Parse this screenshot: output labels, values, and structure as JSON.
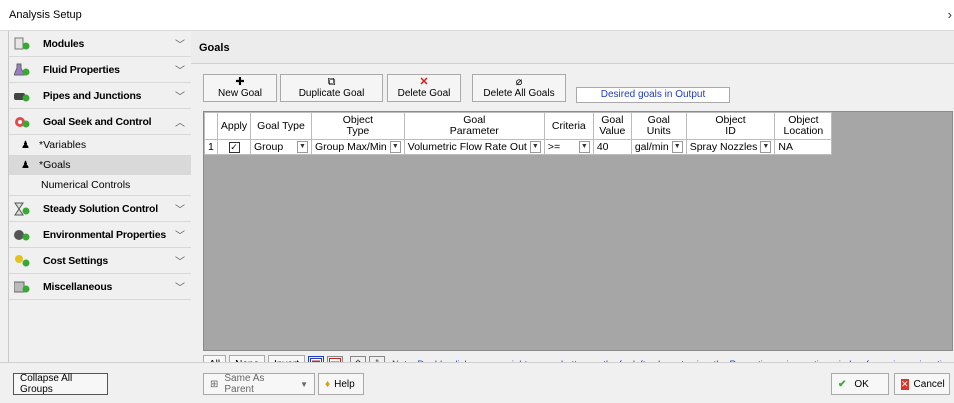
{
  "window": {
    "title": "Analysis Setup",
    "close_glyph": "›"
  },
  "sidebar": {
    "items": [
      {
        "label": "Modules",
        "icon": "modules-icon"
      },
      {
        "label": "Fluid Properties",
        "icon": "flask-icon"
      },
      {
        "label": "Pipes and Junctions",
        "icon": "pipes-icon"
      },
      {
        "label": "Goal Seek and Control",
        "icon": "goal-seek-icon"
      },
      {
        "label": "Steady Solution Control",
        "icon": "hourglass-icon"
      },
      {
        "label": "Environmental Properties",
        "icon": "environment-icon"
      },
      {
        "label": "Cost Settings",
        "icon": "cost-icon"
      },
      {
        "label": "Miscellaneous",
        "icon": "misc-icon"
      }
    ],
    "subitems": {
      "variables": "*Variables",
      "goals": "*Goals",
      "numerical": "Numerical Controls"
    }
  },
  "main": {
    "header": "Goals",
    "toolbar": {
      "new_goal": "New Goal",
      "duplicate_goal": "Duplicate Goal",
      "delete_goal": "Delete Goal",
      "delete_all_goals": "Delete All Goals",
      "desired_goals": "Desired goals in Output"
    },
    "table": {
      "headers": [
        "Apply",
        "Goal Type",
        "Object Type",
        "Goal Parameter",
        "Criteria",
        "Goal Value",
        "Goal Units",
        "Object ID",
        "Object Location"
      ],
      "header_lines": [
        [
          "Apply",
          ""
        ],
        [
          "Goal Type",
          ""
        ],
        [
          "Object",
          "Type"
        ],
        [
          "Goal",
          "Parameter"
        ],
        [
          "Criteria",
          ""
        ],
        [
          "Goal",
          "Value"
        ],
        [
          "Goal",
          "Units"
        ],
        [
          "Object",
          "ID"
        ],
        [
          "Object",
          "Location"
        ]
      ],
      "rows": [
        {
          "num": "1",
          "apply": "☑",
          "goal_type": "Group",
          "object_type": "Group Max/Min",
          "goal_parameter": "Volumetric Flow Rate Out",
          "criteria": ">=",
          "goal_value": "40",
          "goal_units": "gal/min",
          "object_id": "Spray Nozzles",
          "object_location": "NA"
        }
      ]
    },
    "bottom": {
      "all": "All",
      "none": "None",
      "invert": "Invert",
      "note": "Note: Double-click or press right mouse button on the far left column to view the Properties or inspection window for a pipe or junction."
    }
  },
  "footer": {
    "collapse": "Collapse All Groups",
    "same_as_parent": "Same As Parent",
    "help": "Help",
    "ok": "OK",
    "cancel": "Cancel"
  },
  "colors": {
    "accent_blue": "#1d3cc0",
    "grid_bg": "#a6a6a6",
    "ok_green": "#3aa83a",
    "cancel_red": "#d9362b"
  }
}
